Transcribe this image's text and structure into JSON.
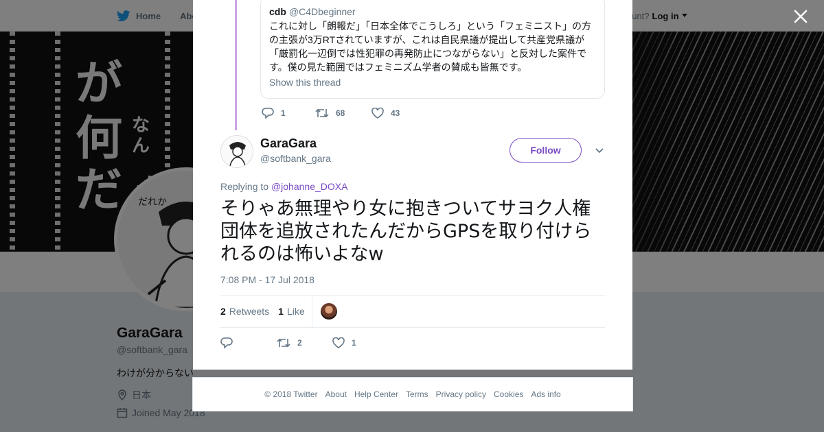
{
  "nav": {
    "home": "Home",
    "about": "Abo",
    "account_prompt": "ccount?",
    "login": "Log in"
  },
  "profile": {
    "name": "GaraGara",
    "handle": "@softbank_gara",
    "bio": "わけが分からない",
    "location": "日本",
    "joined": "Joined May 2018"
  },
  "quote": {
    "name": "cdb",
    "handle": "@C4Dbeginner",
    "text": "これに対し「朗報だ」「日本全体でこうしろ」という「フェミニスト」の方の主張が3万RTされていますが、これは自民県議が提出して共産党県議が「厳罰化一辺倒では性犯罪の再発防止につながらない」と反対した案件です。僕の見た範囲ではフェミニズム学者の賛成も皆無です。",
    "show_thread": "Show this thread",
    "replies": "1",
    "retweets": "68",
    "likes": "43"
  },
  "tweet": {
    "author_name": "GaraGara",
    "author_handle": "@softbank_gara",
    "follow_label": "Follow",
    "replying_label": "Replying to",
    "replying_to": "@johanne_DOXA",
    "text": "そりゃあ無理やり女に抱きついてサヨク人権団体を追放されたんだからGPSを取り付けられるのは怖いよなw",
    "timestamp": "7:08 PM - 17 Jul 2018",
    "retweet_count": "2",
    "retweet_label": "Retweets",
    "like_count": "1",
    "like_label": "Like",
    "action_retweets": "2",
    "action_likes": "1"
  },
  "footer": {
    "copyright": "© 2018 Twitter",
    "links": [
      "About",
      "Help Center",
      "Terms",
      "Privacy policy",
      "Cookies",
      "Ads info"
    ]
  },
  "colors": {
    "accent": "#794bc4",
    "thread_line": "#c9a5e2",
    "twitter_blue": "#1da1f2",
    "muted": "#657786"
  }
}
